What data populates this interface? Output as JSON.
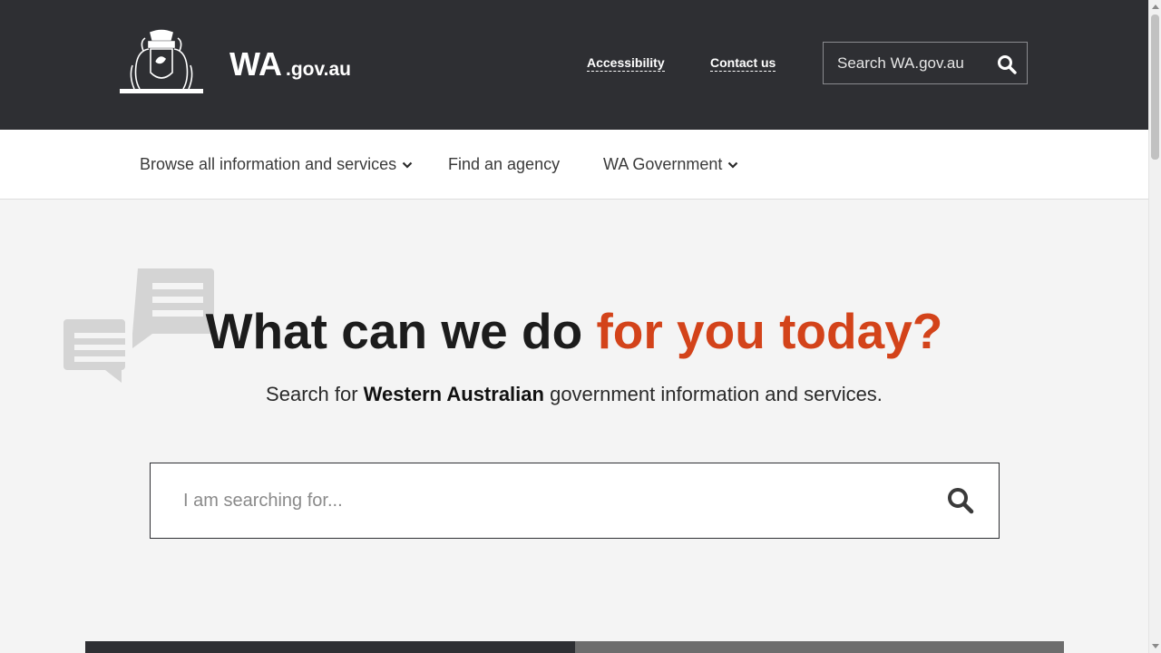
{
  "header": {
    "brand_main": "WA",
    "brand_suffix": ".gov.au",
    "links": {
      "accessibility": "Accessibility",
      "contact": "Contact us"
    },
    "search_placeholder": "Search WA.gov.au"
  },
  "nav": {
    "items": [
      {
        "label": "Browse all information and services",
        "has_dropdown": true
      },
      {
        "label": "Find an agency",
        "has_dropdown": false
      },
      {
        "label": "WA Government",
        "has_dropdown": true
      }
    ]
  },
  "hero": {
    "title_part1": "What can we do",
    "title_part2": "for you today?",
    "subtitle_prefix": "Search for",
    "subtitle_bold": "Western Australian",
    "subtitle_suffix": "government information and services.",
    "search_placeholder": "I am searching for..."
  },
  "colors": {
    "header_bg": "#2e2f33",
    "accent": "#d3431a",
    "page_bg": "#f4f4f4"
  },
  "icons": {
    "crest": "wa-coat-of-arms-icon",
    "search": "search-icon",
    "chevron": "chevron-down-icon",
    "bubbles": "chat-bubbles-icon"
  }
}
